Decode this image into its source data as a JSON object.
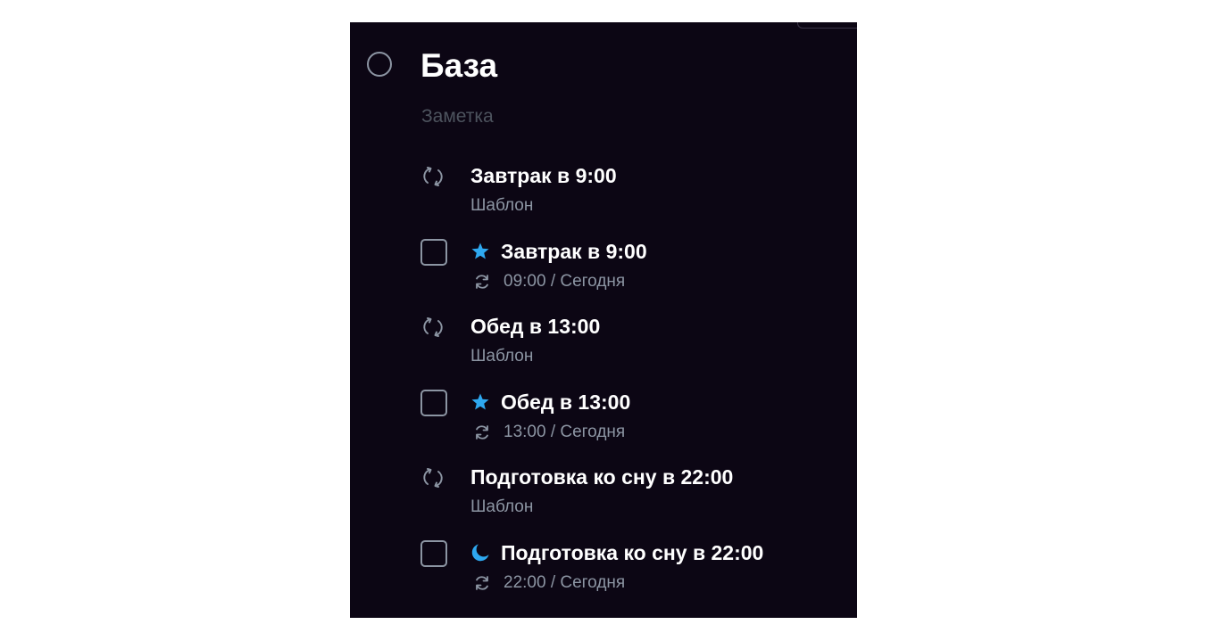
{
  "project": {
    "title": "База",
    "note": "Заметка"
  },
  "colors": {
    "background": "#0c0614",
    "accent": "#2ea8f0",
    "muted": "#8c95a3",
    "note": "#4d535e"
  },
  "tasks": [
    {
      "kind": "template",
      "title": "Завтрак в 9:00",
      "subtitle": "Шаблон",
      "icon": "recurring-icon"
    },
    {
      "kind": "instance",
      "title": "Завтрак в 9:00",
      "subtitle": "09:00 / Сегодня",
      "badge_icon": "star-icon",
      "sub_icon": "repeat-icon"
    },
    {
      "kind": "template",
      "title": "Обед в 13:00",
      "subtitle": "Шаблон",
      "icon": "recurring-icon"
    },
    {
      "kind": "instance",
      "title": "Обед в 13:00",
      "subtitle": "13:00 / Сегодня",
      "badge_icon": "star-icon",
      "sub_icon": "repeat-icon"
    },
    {
      "kind": "template",
      "title": "Подготовка ко сну в 22:00",
      "subtitle": "Шаблон",
      "icon": "recurring-icon"
    },
    {
      "kind": "instance",
      "title": "Подготовка ко сну в 22:00",
      "subtitle": "22:00 / Сегодня",
      "badge_icon": "moon-icon",
      "sub_icon": "repeat-icon"
    }
  ]
}
